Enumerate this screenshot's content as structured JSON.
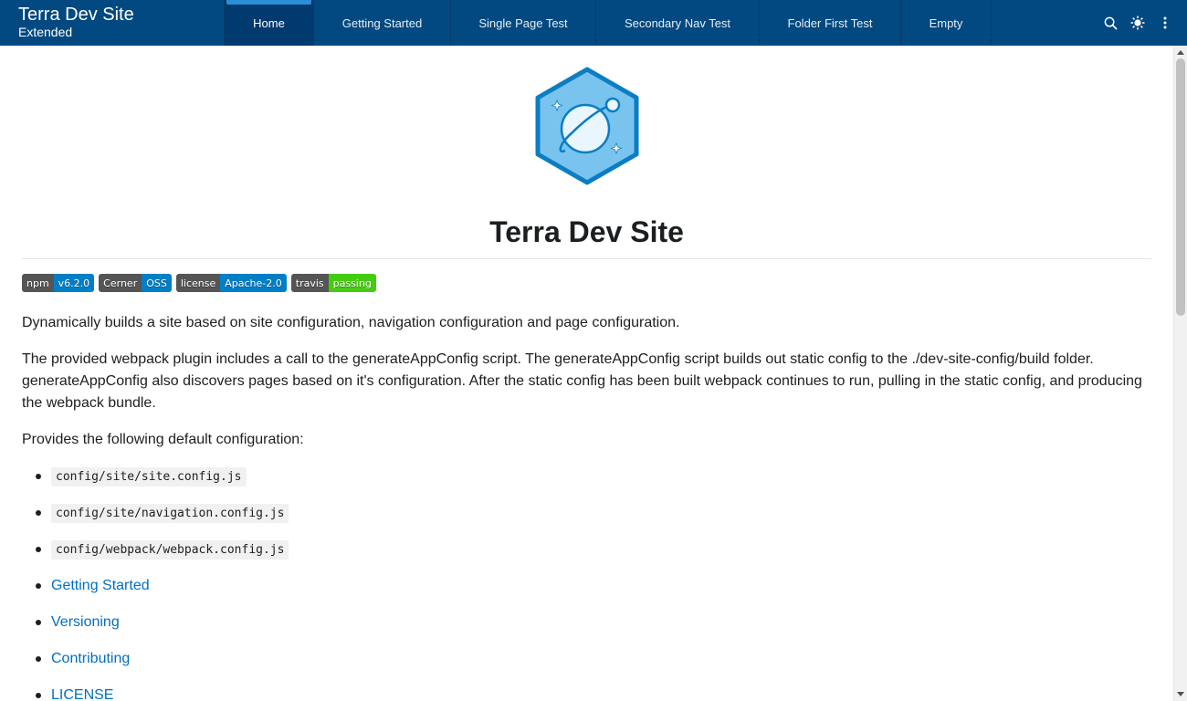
{
  "brand": {
    "title": "Terra Dev Site",
    "subtitle": "Extended"
  },
  "nav": {
    "tabs": [
      {
        "label": "Home",
        "active": true
      },
      {
        "label": "Getting Started"
      },
      {
        "label": "Single Page Test"
      },
      {
        "label": "Secondary Nav Test"
      },
      {
        "label": "Folder First Test"
      },
      {
        "label": "Empty"
      }
    ],
    "icons": [
      "search-icon",
      "theme-icon",
      "more-vertical-icon"
    ]
  },
  "page": {
    "title": "Terra Dev Site",
    "badges": [
      {
        "left": "npm",
        "right": "v6.2.0",
        "color": "#007ec6"
      },
      {
        "left": "Cerner",
        "right": "OSS",
        "color": "#007ec6"
      },
      {
        "left": "license",
        "right": "Apache-2.0",
        "color": "#007ec6"
      },
      {
        "left": "travis",
        "right": "passing",
        "color": "#4c1"
      }
    ],
    "paragraphs": [
      "Dynamically builds a site based on site configuration, navigation configuration and page configuration.",
      "The provided webpack plugin includes a call to the generateAppConfig script. The generateAppConfig script builds out static config to the ./dev-site-config/build folder. generateAppConfig also discovers pages based on it's configuration. After the static config has been built webpack continues to run, pulling in the static config, and producing the webpack bundle.",
      "Provides the following default configuration:"
    ],
    "list": [
      {
        "type": "code",
        "text": "config/site/site.config.js"
      },
      {
        "type": "code",
        "text": "config/site/navigation.config.js"
      },
      {
        "type": "code",
        "text": "config/webpack/webpack.config.js"
      },
      {
        "type": "link",
        "text": "Getting Started"
      },
      {
        "type": "link",
        "text": "Versioning"
      },
      {
        "type": "link",
        "text": "Contributing"
      },
      {
        "type": "link",
        "text": "LICENSE"
      }
    ]
  },
  "colors": {
    "header": "#014980",
    "link": "#006fc3"
  }
}
